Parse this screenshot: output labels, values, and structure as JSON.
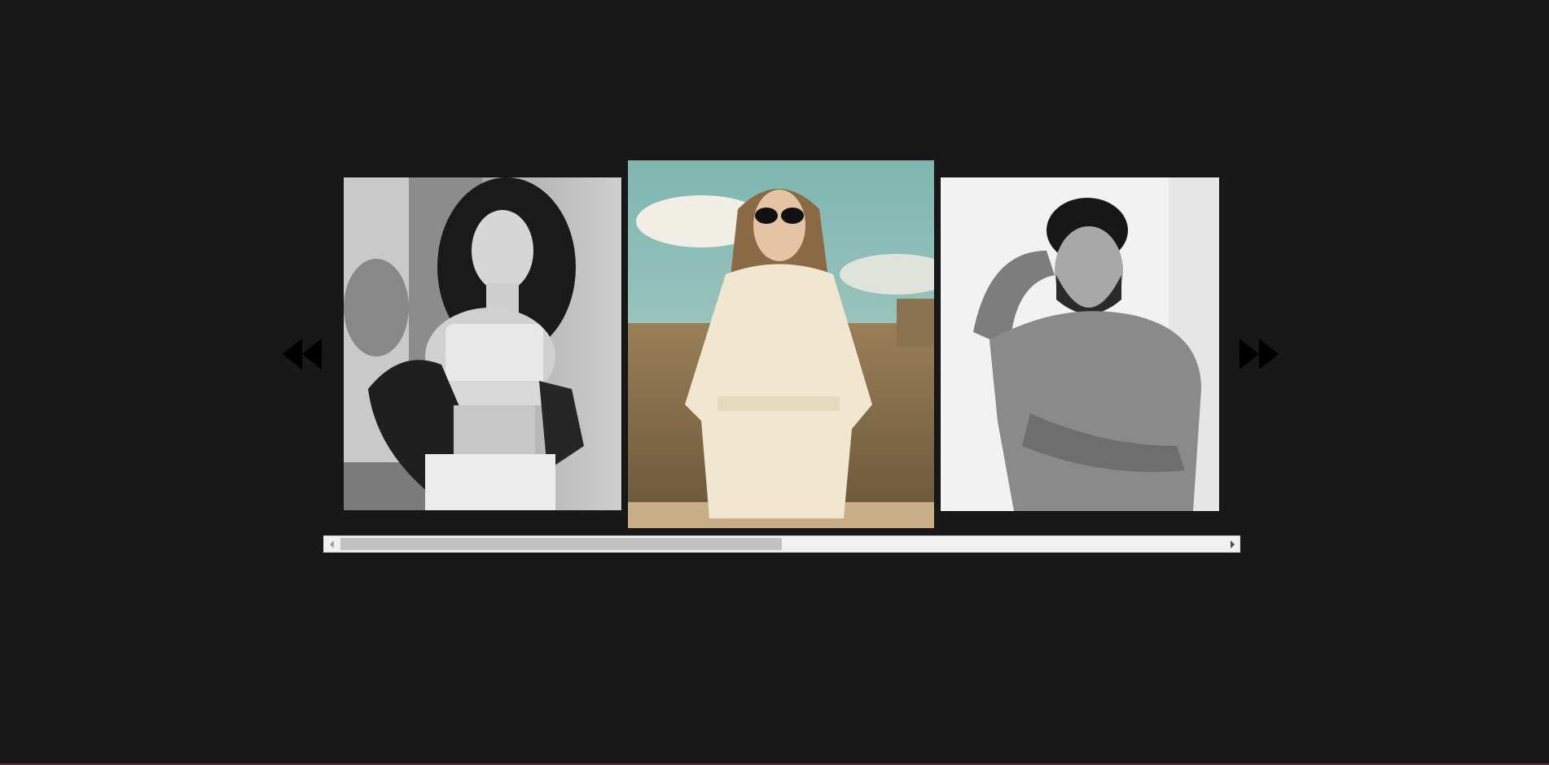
{
  "gallery": {
    "prev_icon": "double-triangle-left-icon",
    "next_icon": "double-triangle-right-icon",
    "arrow_color": "#000000",
    "background_color": "#181818",
    "photos": [
      {
        "name": "photo-curly-hair-woman",
        "style": "black-and-white"
      },
      {
        "name": "photo-woman-sunglasses",
        "style": "color"
      },
      {
        "name": "photo-bearded-man",
        "style": "black-and-white"
      }
    ]
  },
  "scrollbar": {
    "left_icon": "scroll-left-arrow-icon",
    "right_icon": "scroll-right-arrow-icon",
    "thumb_fraction": 0.5,
    "position_fraction": 0.0,
    "track_color": "#f1f1f1",
    "thumb_color": "#c1c1c1"
  }
}
